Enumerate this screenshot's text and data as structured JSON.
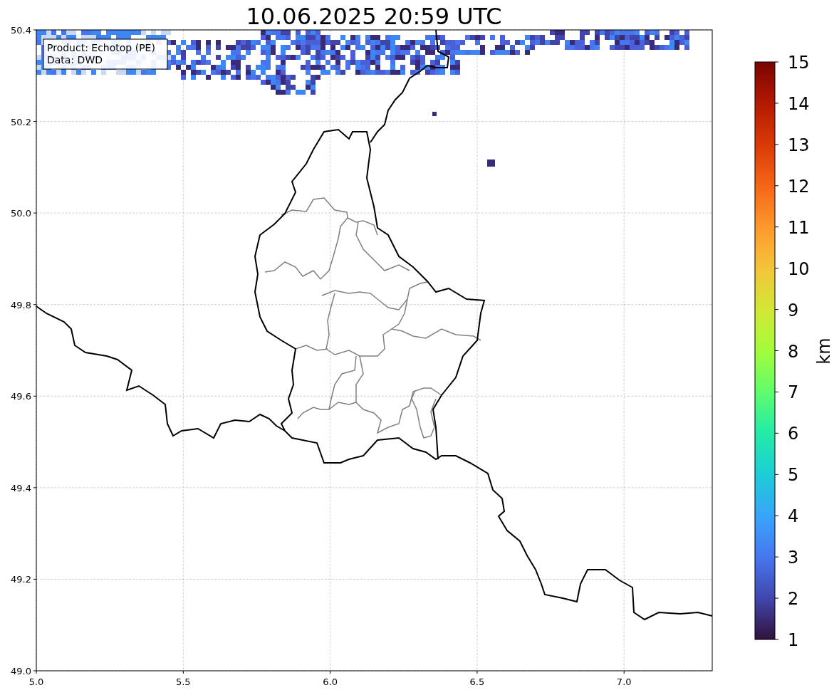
{
  "title": "10.06.2025 20:59 UTC",
  "info_box": [
    "Product: Echotop (PE)",
    "Data: DWD"
  ],
  "x_ticks": [
    "5.0",
    "5.5",
    "6.0",
    "6.5",
    "7.0"
  ],
  "y_ticks": [
    "50.4",
    "50.2",
    "50.0",
    "49.8",
    "49.6",
    "49.4",
    "49.2",
    "49.0"
  ],
  "colorbar": {
    "label": "km",
    "ticks": [
      "15",
      "14",
      "13",
      "12",
      "11",
      "10",
      "9",
      "8",
      "7",
      "6",
      "5",
      "4",
      "3",
      "2",
      "1"
    ]
  }
}
